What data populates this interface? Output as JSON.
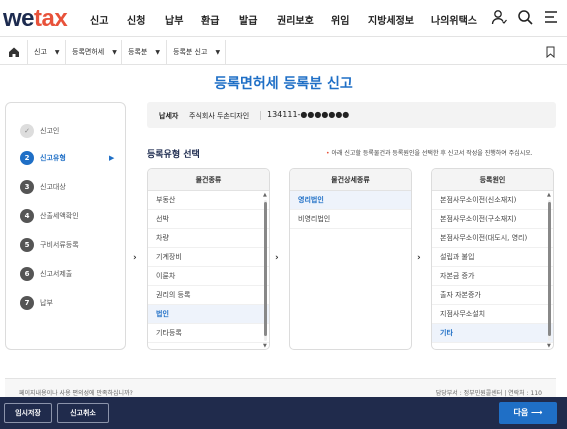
{
  "brand": {
    "logo_we": "we",
    "logo_tax": "tax"
  },
  "nav": {
    "items": [
      "신고",
      "신청",
      "납부",
      "환급",
      "발급",
      "권리보호",
      "위임",
      "지방세정보",
      "나의위택스"
    ]
  },
  "breadcrumb": {
    "items": [
      "신고",
      "등록면허세",
      "등록분",
      "등록분 신고"
    ]
  },
  "page_title": "등록면허세 등록분 신고",
  "steps": {
    "items": [
      {
        "num": "✓",
        "label": "신고인",
        "state": "done"
      },
      {
        "num": "2",
        "label": "신고유형",
        "state": "active"
      },
      {
        "num": "3",
        "label": "신고대상",
        "state": "todo"
      },
      {
        "num": "4",
        "label": "산출세액확인",
        "state": "todo"
      },
      {
        "num": "5",
        "label": "구비서류등록",
        "state": "todo"
      },
      {
        "num": "6",
        "label": "신고서제출",
        "state": "todo"
      },
      {
        "num": "7",
        "label": "납부",
        "state": "todo"
      }
    ],
    "active_arrow": "▶"
  },
  "taxpayer": {
    "label": "납세자",
    "name": "주식회사 두손디자인",
    "reg_no": "134111-●●●●●●●"
  },
  "section": {
    "title": "등록유형 선택",
    "hint_bullet": "•",
    "hint": "아래 신고할 등록물건과 등록원인을 선택한 후 신고서 작성을 진행하여 주십시오."
  },
  "columns": [
    {
      "header": "물건종류",
      "items": [
        "부동산",
        "선박",
        "차량",
        "기계장비",
        "이륜차",
        "권리의 등록",
        "법인",
        "기타등록"
      ],
      "selected": 6,
      "scroll_thumb_fraction": 0.95
    },
    {
      "header": "물건상세종류",
      "items": [
        "영리법인",
        "비영리법인"
      ],
      "selected": 0
    },
    {
      "header": "등록원인",
      "items": [
        "본점사무소이전(신소재지)",
        "본점사무소이전(구소재지)",
        "본점사무소이전(대도시, 영리)",
        "설립과 불입",
        "자본금 증가",
        "출자 자본증가",
        "지점사무소설치",
        "기타"
      ],
      "selected": 7,
      "scroll_thumb_fraction": 0.95
    }
  ],
  "footer": {
    "question": "페이지내용이나 사용 편의성에 만족하십니까?",
    "info": "담당부서 : 정부민원콜센터  |  연락처 : 110"
  },
  "actions": {
    "temp_save": "임시저장",
    "cancel": "신고취소",
    "next": "다음"
  },
  "colors": {
    "brand_navy": "#1d2b4f",
    "accent_red": "#e8523a",
    "primary_blue": "#1f6fc6",
    "bottom_bar": "#202b4c"
  }
}
